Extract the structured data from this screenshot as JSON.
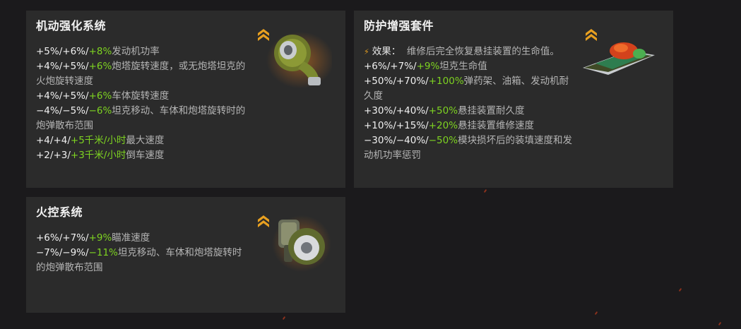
{
  "colors": {
    "background": "#1b1a1c",
    "card": "#2b2b2b",
    "highlight": "#7ed321",
    "rank_icon": "#e8a020"
  },
  "cards": [
    {
      "title": "机动强化系统",
      "rank_icon": "chevron-rank-icon",
      "module_icon": "turbocharger-icon",
      "lines": [
        {
          "prefix": "+5%/+6%/",
          "elite": "+8%",
          "text": "发动机功率"
        },
        {
          "prefix": "+4%/+5%/",
          "elite": "+6%",
          "text": "炮塔旋转速度，或无炮塔坦克的火炮旋转速度"
        },
        {
          "prefix": "+4%/+5%/",
          "elite": "+6%",
          "text": "车体旋转速度"
        },
        {
          "prefix": "−4%/−5%/",
          "elite": "−6%",
          "text": "坦克移动、车体和炮塔旋转时的炮弹散布范围"
        },
        {
          "prefix": "+4/+4/",
          "elite": "+5千米/小时",
          "text": "最大速度"
        },
        {
          "prefix": "+2/+3/",
          "elite": "+3千米/小时",
          "text": "倒车速度"
        }
      ]
    },
    {
      "title": "防护增强套件",
      "rank_icon": "chevron-rank-icon",
      "module_icon": "tank-suspension-icon",
      "effect": {
        "icon": "lightning-icon",
        "label": "效果：",
        "text": "维修后完全恢复悬挂装置的生命值。"
      },
      "lines": [
        {
          "prefix": "+6%/+7%/",
          "elite": "+9%",
          "text": "坦克生命值"
        },
        {
          "prefix": "+50%/+70%/",
          "elite": "+100%",
          "text": "弹药架、油箱、发动机耐久度"
        },
        {
          "prefix": "+30%/+40%/",
          "elite": "+50%",
          "text": "悬挂装置耐久度"
        },
        {
          "prefix": "+10%/+15%/",
          "elite": "+20%",
          "text": "悬挂装置维修速度"
        },
        {
          "prefix": "−30%/−40%/",
          "elite": "−50%",
          "text": "模块损坏后的装填速度和发动机功率惩罚"
        }
      ]
    },
    {
      "title": "火控系统",
      "rank_icon": "chevron-rank-icon",
      "module_icon": "gun-stabilizer-icon",
      "lines": [
        {
          "prefix": "+6%/+7%/",
          "elite": "+9%",
          "text": "瞄准速度"
        },
        {
          "prefix": "−7%/−9%/",
          "elite": "−11%",
          "text": "坦克移动、车体和炮塔旋转时的炮弹散布范围"
        }
      ]
    }
  ]
}
